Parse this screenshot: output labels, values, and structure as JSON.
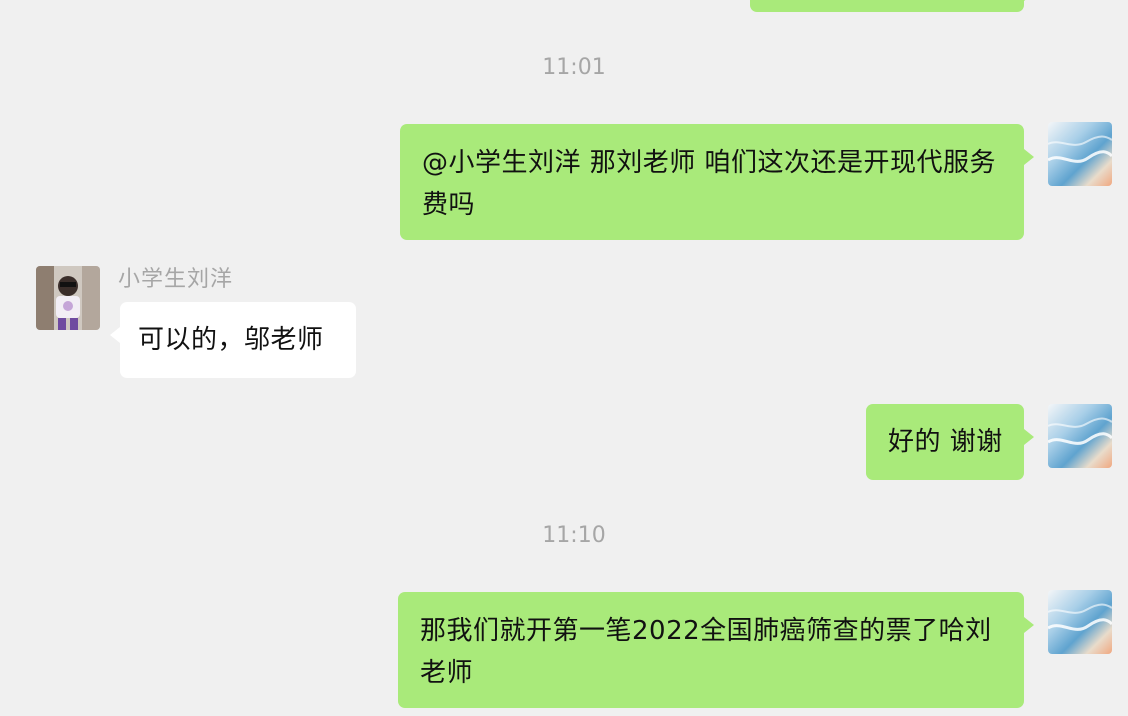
{
  "chat": {
    "timestamps": [
      "11:01",
      "11:10"
    ],
    "messages": [
      {
        "direction": "outgoing",
        "text": ""
      },
      {
        "direction": "outgoing",
        "text": "@小学生刘洋 那刘老师 咱们这次还是开现代服务费吗"
      },
      {
        "direction": "incoming",
        "sender": "小学生刘洋",
        "text": "可以的，邬老师"
      },
      {
        "direction": "outgoing",
        "text": "好的 谢谢"
      },
      {
        "direction": "outgoing",
        "text": "那我们就开第一笔2022全国肺癌筛查的票了哈刘老师"
      }
    ]
  },
  "avatars": {
    "self": "ocean-beach-avatar",
    "contact": "child-photo-avatar"
  },
  "colors": {
    "background": "#F0F0F0",
    "outgoing_bubble": "#A9EA7A",
    "incoming_bubble": "#FFFFFF",
    "timestamp_text": "#A6A6A6",
    "message_text": "#111111"
  }
}
